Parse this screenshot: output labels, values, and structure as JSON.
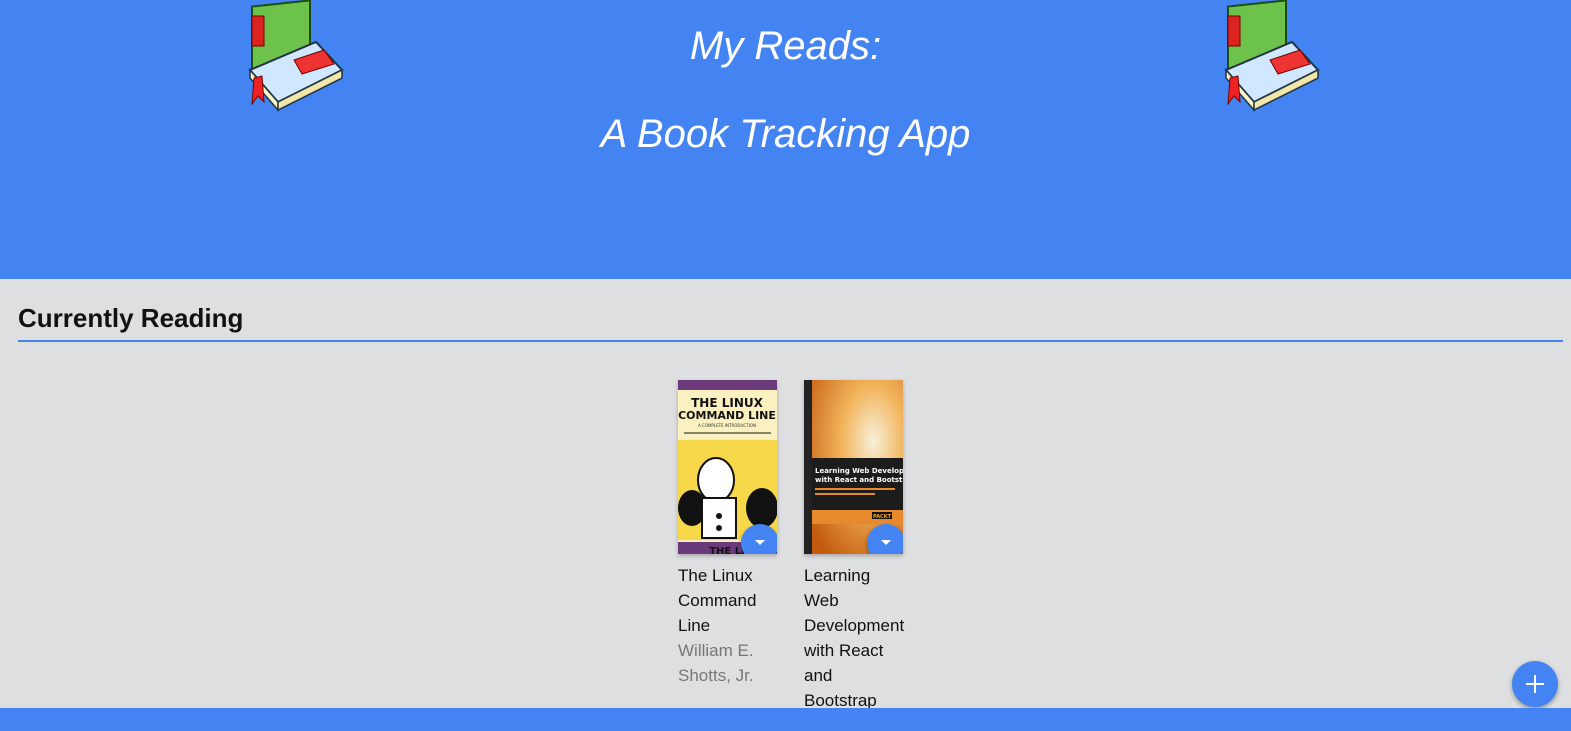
{
  "header": {
    "title_line1": "My Reads:",
    "title_line2": "A Book Tracking App",
    "logo_icon": "books-icon",
    "bg_color": "#4384f2"
  },
  "shelves": [
    {
      "title": "Currently Reading",
      "books": [
        {
          "title": "The Linux Command Line",
          "authors": "William E. Shotts, Jr.",
          "cover_text": [
            "THE LINUX",
            "COMMAND LINE",
            "A COMPLETE INTRODUCTION",
            "THE LI"
          ]
        },
        {
          "title": "Learning Web Development with React and Bootstrap",
          "authors": "",
          "cover_text": [
            "Learning Web Development",
            "with React and Bootstrap",
            "PACKT"
          ]
        }
      ]
    }
  ],
  "actions": {
    "shelf_changer_icon": "caret-down-icon",
    "add_book_icon": "plus-icon"
  }
}
